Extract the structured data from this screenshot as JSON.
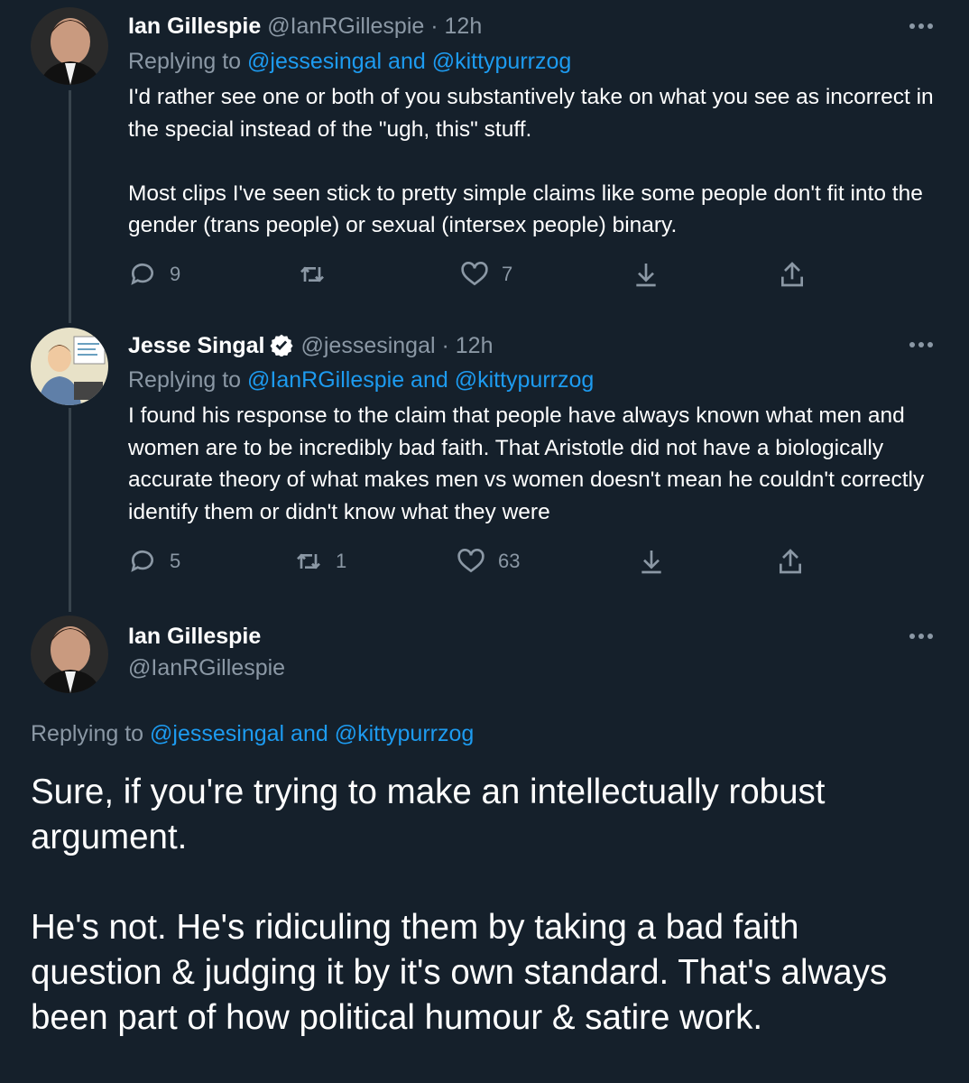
{
  "tweets": [
    {
      "name": "Ian Gillespie",
      "handle": "@IanRGillespie",
      "time": "· 12h",
      "replying_prefix": "Replying to",
      "replying_users": "@jessesingal and @kittypurrzog",
      "text": "I'd rather see one or both of you substantively take on what you see as incorrect in the special instead of the \"ugh, this\" stuff.\n\nMost clips I've seen stick to pretty simple claims like some people don't fit into the gender (trans people) or sexual (intersex people) binary.",
      "replies": "9",
      "retweets": "",
      "likes": "7"
    },
    {
      "name": "Jesse Singal",
      "handle": "@jessesingal",
      "time": "· 12h",
      "replying_prefix": "Replying to",
      "replying_users": "@IanRGillespie and @kittypurrzog",
      "text": "I found his response to the claim that people have always known what men and women are to be incredibly bad faith. That Aristotle did not have a biologically accurate theory of what makes men vs women doesn't mean he couldn't correctly identify them or didn't know what they were",
      "replies": "5",
      "retweets": "1",
      "likes": "63"
    }
  ],
  "focus_tweet": {
    "name": "Ian Gillespie",
    "handle": "@IanRGillespie",
    "replying_prefix": "Replying to",
    "replying_users": "@jessesingal and @kittypurrzog",
    "text": "Sure, if you're trying to make an intellectually robust argument.\n\nHe's not. He's ridiculing them by taking a bad faith question & judging it by it's own standard. That's always been part of how political humour & satire work."
  },
  "colors": {
    "background": "#15202b",
    "text": "#ffffff",
    "muted": "#8b98a5",
    "link": "#1d9bf0",
    "thread_line": "#38444d"
  },
  "icons": [
    "reply-icon",
    "retweet-icon",
    "like-icon",
    "download-icon",
    "share-icon",
    "more-icon",
    "verified-badge-icon"
  ]
}
